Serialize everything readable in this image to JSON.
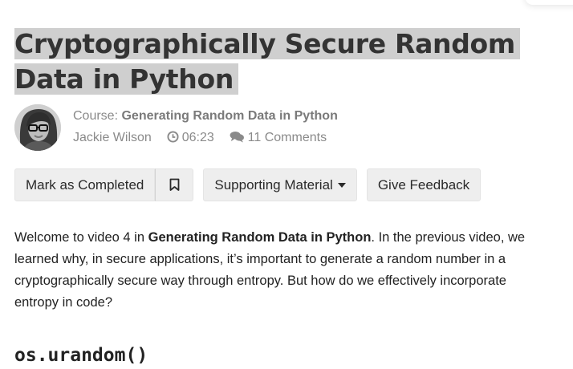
{
  "lesson": {
    "title": "Cryptographically Secure Random Data in Python"
  },
  "meta": {
    "course_prefix": "Course:",
    "course_title": "Generating Random Data in Python",
    "author": "Jackie Wilson",
    "duration": "06:23",
    "comments": "11 Comments"
  },
  "actions": {
    "mark_completed": "Mark as Completed",
    "supporting_material": "Supporting Material",
    "give_feedback": "Give Feedback"
  },
  "content": {
    "intro_1": "Welcome to video 4 in ",
    "intro_bold": "Generating Random Data in Python",
    "intro_2": ". In the previous video, we learned why, in secure applications, it’s important to generate a random number in a cryptographically secure way through entropy. But how do we effectively incorporate entropy in code?",
    "heading": "os.urandom()"
  },
  "icons": {
    "clock": "clock-icon",
    "comments": "comments-icon",
    "bookmark": "bookmark-icon",
    "caret": "caret-down-icon"
  },
  "colors": {
    "title_highlight": "#cfcfcf",
    "button_bg": "#eeeeee",
    "meta_text": "#8a8a8a"
  }
}
